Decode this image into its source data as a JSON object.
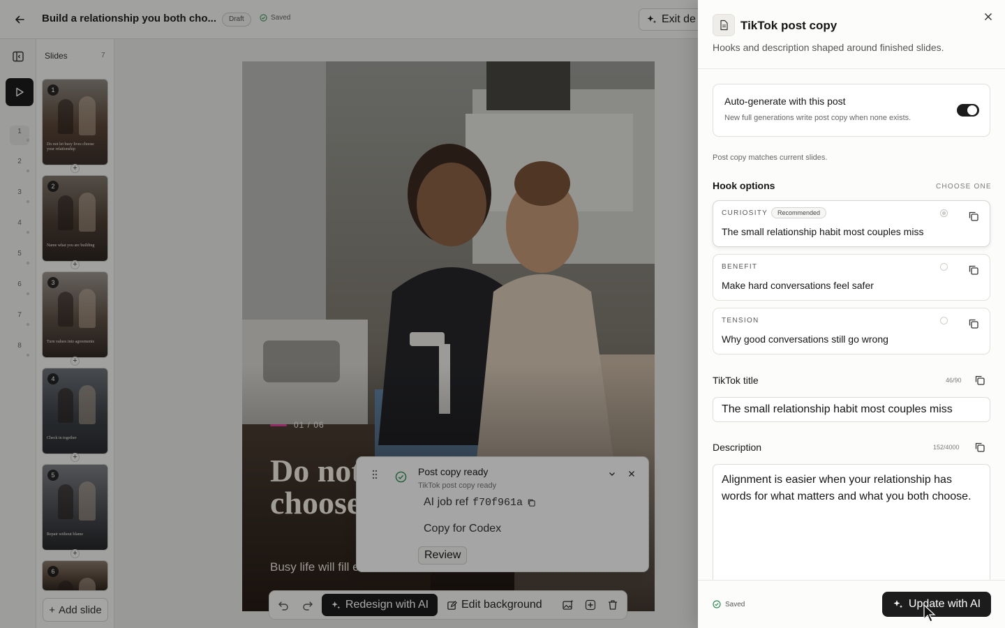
{
  "header": {
    "back_icon": "arrow-left-icon",
    "title": "Build a relationship you both cho...",
    "draft_badge": "Draft",
    "saved_status": "Saved",
    "exit_label": "Exit de"
  },
  "rail": {
    "toggle_icon": "sidebar-toggle-icon",
    "play_icon": "play-icon",
    "numbers": [
      "1",
      "2",
      "3",
      "4",
      "5",
      "6",
      "7",
      "8"
    ]
  },
  "slides_panel": {
    "label": "Slides",
    "count": "7",
    "thumbs": [
      {
        "number": "1",
        "caption": "Do not let busy lives choose your relationship"
      },
      {
        "number": "2",
        "caption": "Name what you are building"
      },
      {
        "number": "3",
        "caption": "Turn values into agreements"
      },
      {
        "number": "4",
        "caption": "Check in together"
      },
      {
        "number": "5",
        "caption": "Repair without blame"
      },
      {
        "number": "6",
        "caption": ""
      }
    ],
    "add_slide_label": "Add slide"
  },
  "slide": {
    "indicator": "01 / 06",
    "headline_line1": "Do not",
    "headline_line2": "choose",
    "subtext": "Busy life will fill e",
    "accent_color": "#e0419a"
  },
  "toolbar": {
    "undo_icon": "undo-icon",
    "redo_icon": "redo-icon",
    "redesign_label": "Redesign with AI",
    "edit_background_label": "Edit background",
    "image_icon": "image-sparkle-icon",
    "add_icon": "plus-icon",
    "delete_icon": "trash-icon"
  },
  "toast": {
    "title": "Post copy ready",
    "subtitle": "TikTok post copy ready",
    "job_label": "AI job ref",
    "job_ref": "f70f961a",
    "copy_codex_label": "Copy for Codex",
    "review_label": "Review"
  },
  "panel": {
    "title": "TikTok post copy",
    "subtitle": "Hooks and description shaped around finished slides.",
    "auto_generate": {
      "title": "Auto-generate with this post",
      "description": "New full generations write post copy when none exists.",
      "enabled": true
    },
    "match_note": "Post copy matches current slides.",
    "hook_heading": "Hook options",
    "choose_one": "CHOOSE ONE",
    "hooks": [
      {
        "tag": "CURIOSITY",
        "badge": "Recommended",
        "text": "The small relationship habit most couples miss",
        "selected": true
      },
      {
        "tag": "BENEFIT",
        "badge": "",
        "text": "Make hard conversations feel safer",
        "selected": false
      },
      {
        "tag": "TENSION",
        "badge": "",
        "text": "Why good conversations still go wrong",
        "selected": false
      }
    ],
    "tiktok_title": {
      "label": "TikTok title",
      "count": "46/90",
      "value": "The small relationship habit most couples miss"
    },
    "description": {
      "label": "Description",
      "count": "152/4000",
      "value": "Alignment is easier when your relationship has words for what matters and what you both choose."
    },
    "footer": {
      "saved": "Saved",
      "update_label": "Update with AI"
    }
  }
}
